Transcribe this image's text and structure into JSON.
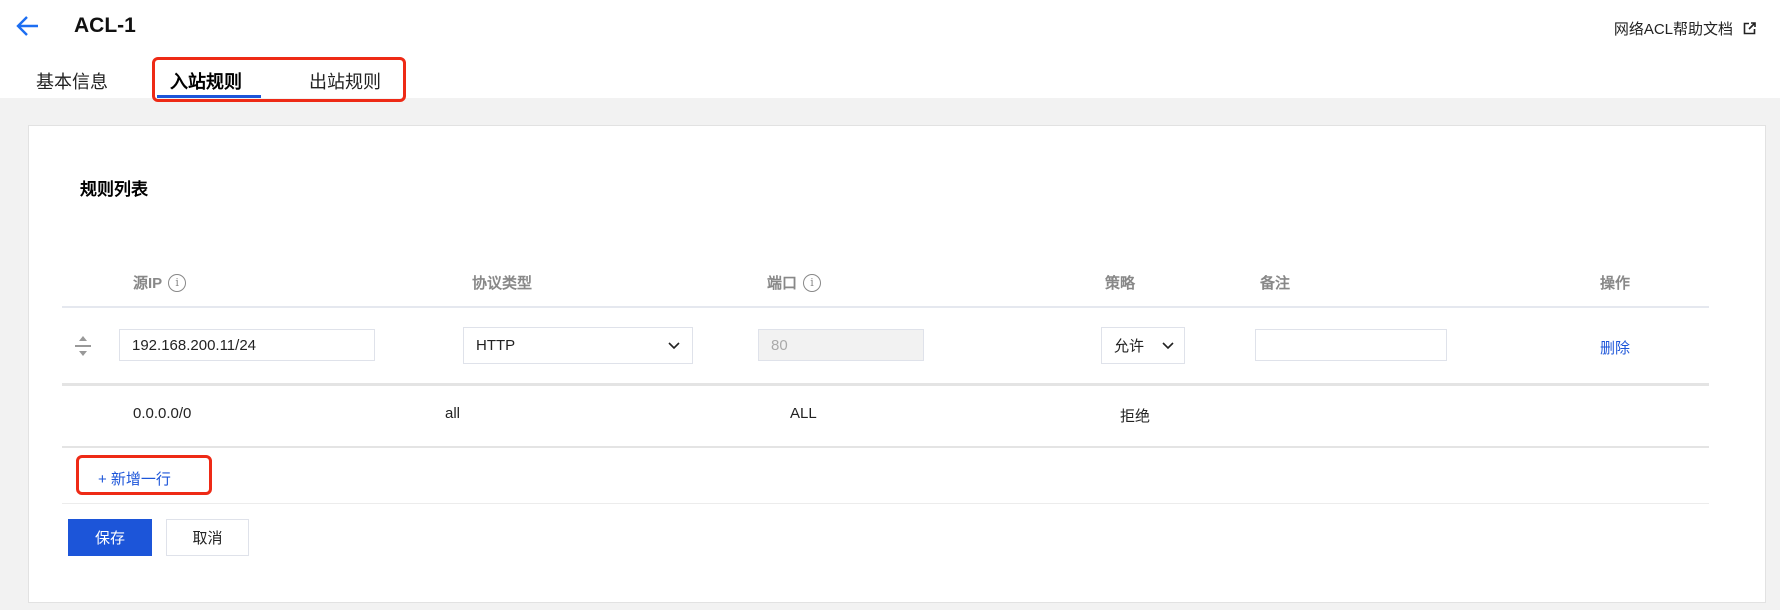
{
  "header": {
    "title": "ACL-1",
    "help_link": "网络ACL帮助文档"
  },
  "tabs": [
    {
      "label": "基本信息"
    },
    {
      "label": "入站规则"
    },
    {
      "label": "出站规则"
    }
  ],
  "section_title": "规则列表",
  "table": {
    "columns": [
      "源IP",
      "协议类型",
      "端口",
      "策略",
      "备注",
      "操作"
    ],
    "edit_row": {
      "source_ip": "192.168.200.11/24",
      "protocol": "HTTP",
      "port": "80",
      "policy": "允许",
      "remark": "",
      "action": "删除"
    },
    "rows": [
      {
        "source_ip": "0.0.0.0/0",
        "protocol": "all",
        "port": "ALL",
        "policy": "拒绝"
      }
    ]
  },
  "add_row": "+ 新增一行",
  "buttons": {
    "save": "保存",
    "cancel": "取消"
  },
  "colors": {
    "accent": "#1c55d9",
    "highlight": "#ee2a16"
  }
}
